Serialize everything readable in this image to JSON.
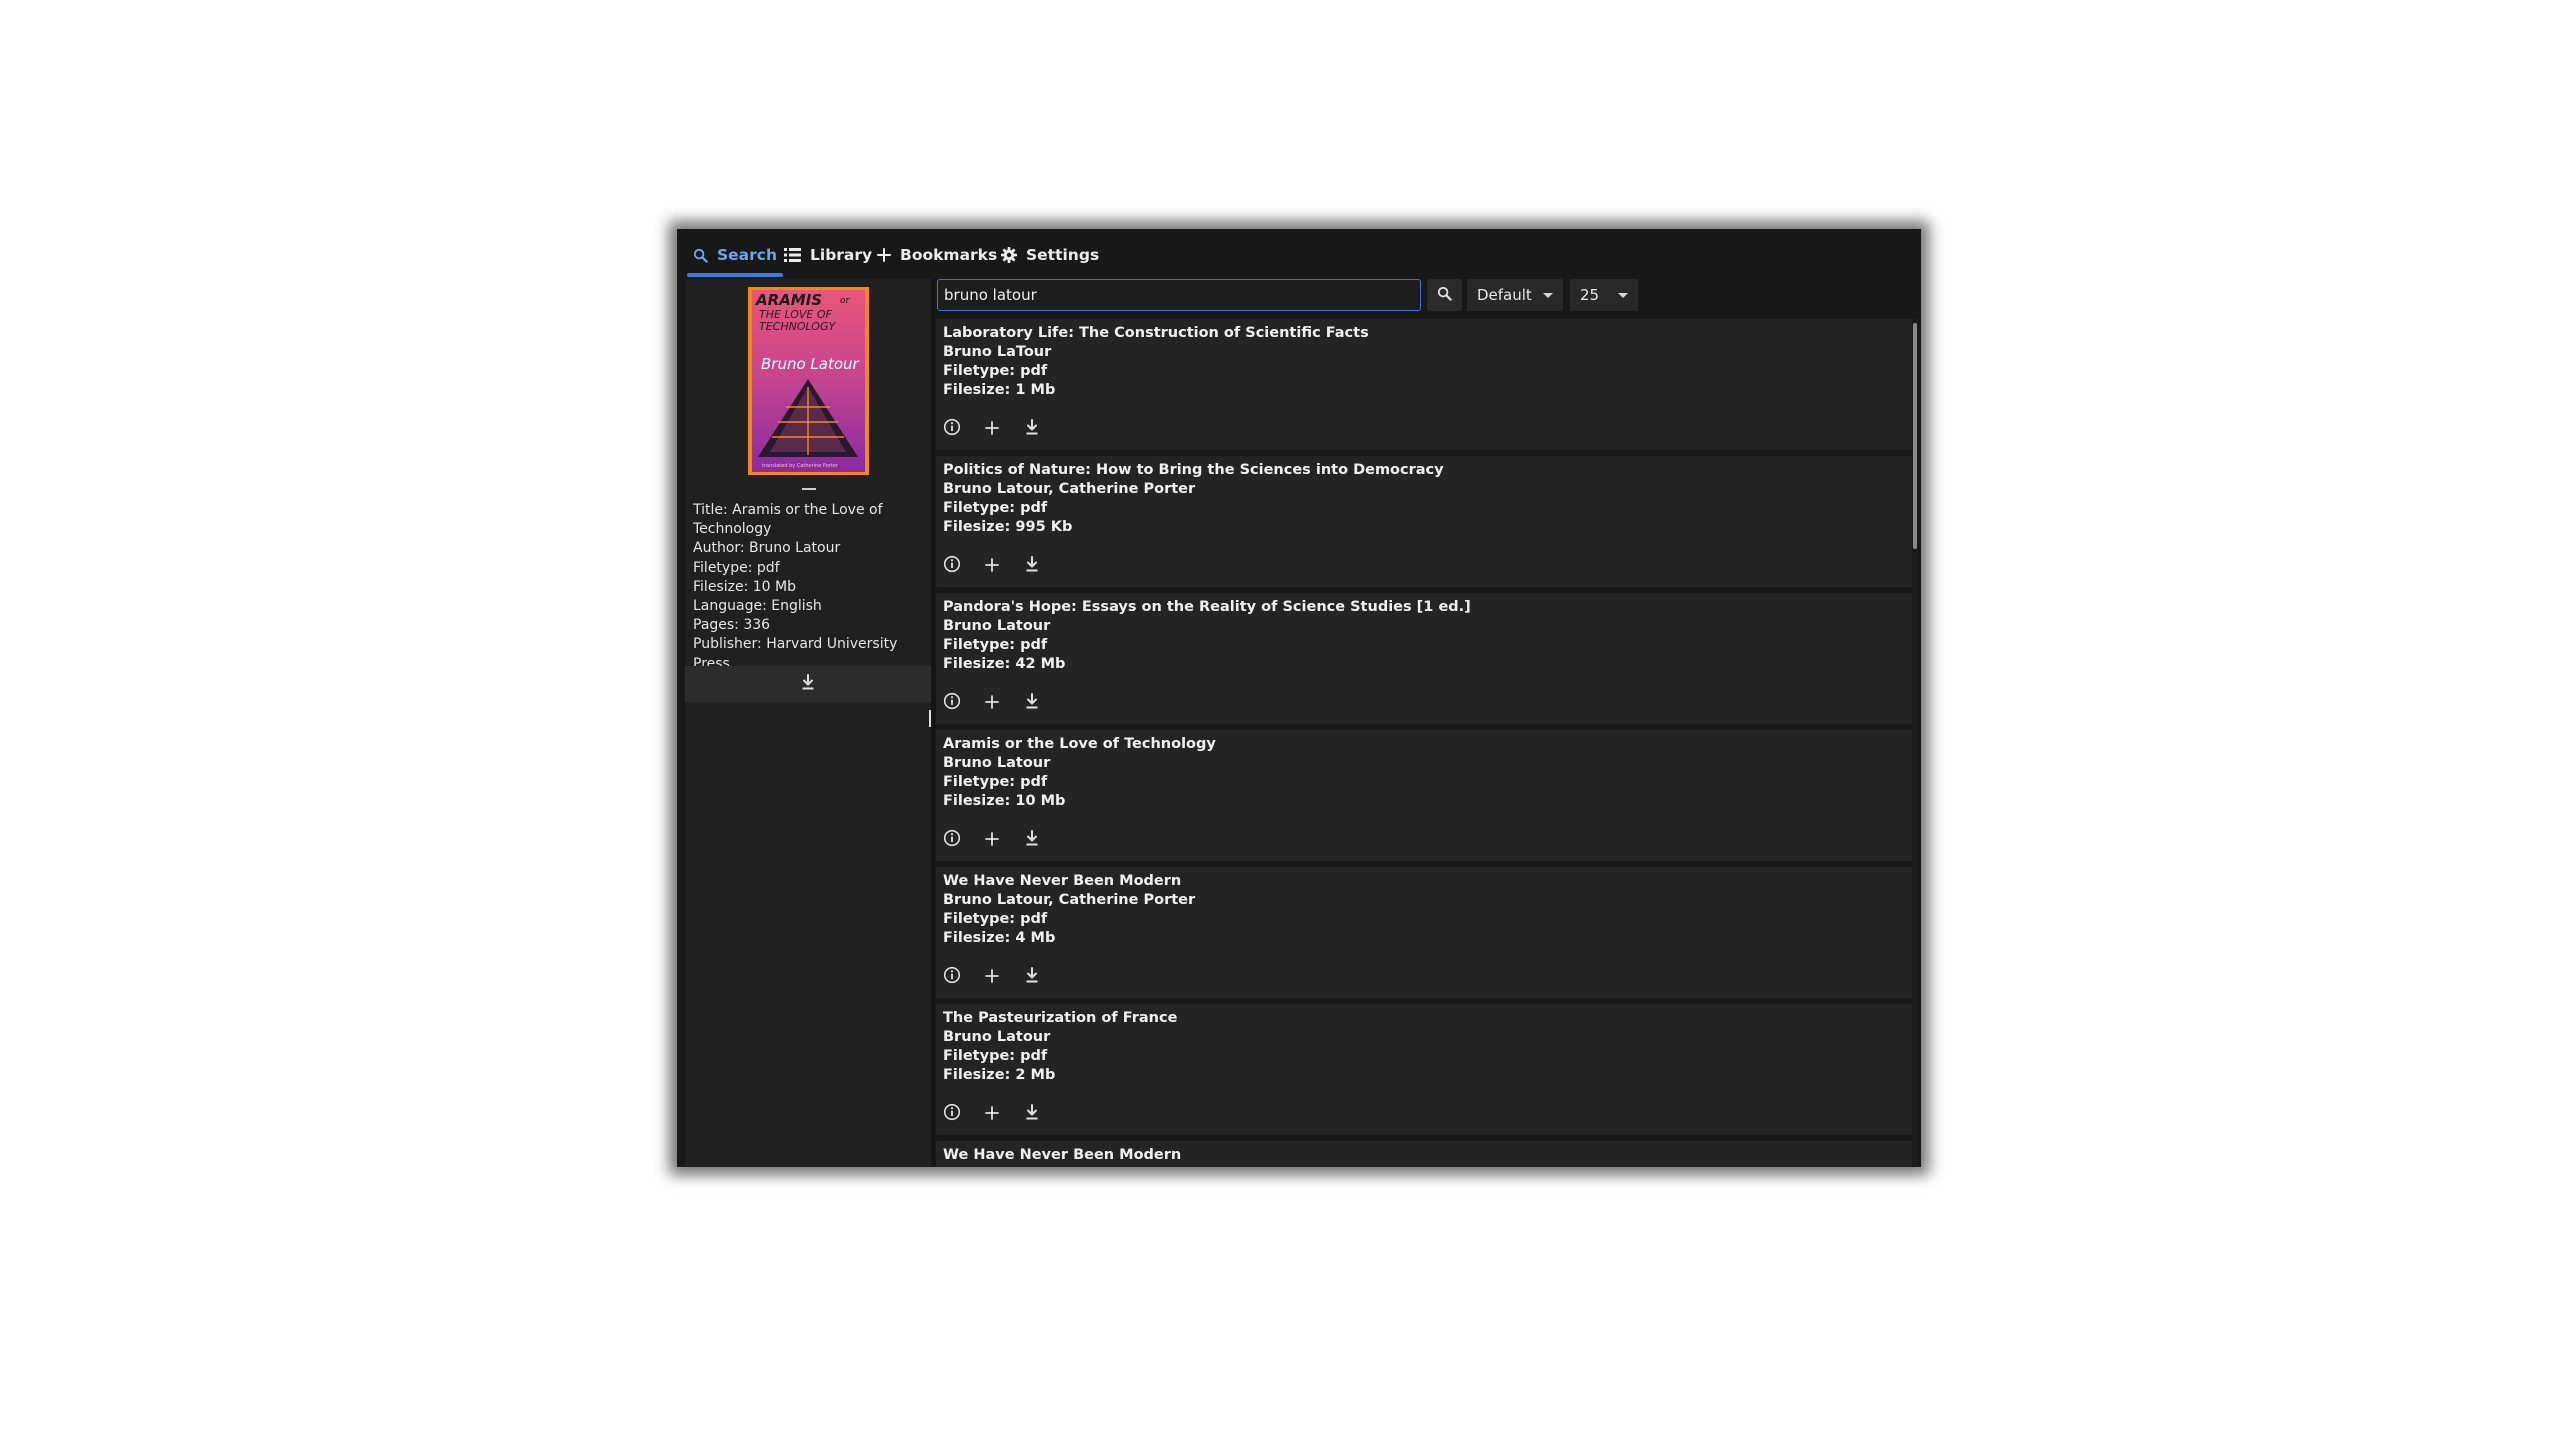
{
  "tabs": [
    {
      "label": "Search",
      "icon": "search-icon",
      "active": true
    },
    {
      "label": "Library",
      "icon": "list-icon",
      "active": false
    },
    {
      "label": "Bookmarks",
      "icon": "plus-icon",
      "active": false
    },
    {
      "label": "Settings",
      "icon": "gear-icon",
      "active": false
    }
  ],
  "search": {
    "value": "bruno latour"
  },
  "sort_select": {
    "value": "Default"
  },
  "count_select": {
    "value": "25"
  },
  "selected_book": {
    "cover": {
      "title_lines": [
        "ARAMIS",
        "or",
        "THE LOVE OF",
        "TECHNOLOGY"
      ],
      "author": "Bruno Latour",
      "bottom_text": "translated by Catherine Porter",
      "colors": {
        "background": "#d7436a",
        "border": "#f08a12",
        "text": "#1a1a1a"
      }
    },
    "meta": [
      "Title: Aramis or the Love of Technology",
      "Author: Bruno Latour",
      "Filetype: pdf",
      "Filesize: 10 Mb",
      "Language: English",
      "Pages: 336",
      "Publisher: Harvard University Press"
    ]
  },
  "results": [
    {
      "title": "Laboratory Life: The Construction of Scientific Facts",
      "author": "Bruno LaTour",
      "filetype": "Filetype: pdf",
      "filesize": "Filesize: 1 Mb"
    },
    {
      "title": "Politics of Nature: How to Bring the Sciences into Democracy",
      "author": "Bruno Latour, Catherine Porter",
      "filetype": "Filetype: pdf",
      "filesize": "Filesize: 995 Kb"
    },
    {
      "title": "Pandora's Hope: Essays on the Reality of Science Studies [1 ed.]",
      "author": "Bruno Latour",
      "filetype": "Filetype: pdf",
      "filesize": "Filesize: 42 Mb"
    },
    {
      "title": "Aramis or the Love of Technology",
      "author": "Bruno Latour",
      "filetype": "Filetype: pdf",
      "filesize": "Filesize: 10 Mb"
    },
    {
      "title": "We Have Never Been Modern",
      "author": "Bruno Latour, Catherine Porter",
      "filetype": "Filetype: pdf",
      "filesize": "Filesize: 4 Mb"
    },
    {
      "title": "The Pasteurization of France",
      "author": "Bruno Latour",
      "filetype": "Filetype: pdf",
      "filesize": "Filesize: 2 Mb"
    },
    {
      "title": "We Have Never Been Modern",
      "author": "",
      "filetype": "",
      "filesize": ""
    }
  ],
  "result_actions": [
    "info-icon",
    "plus-icon",
    "download-icon"
  ],
  "colors": {
    "accent": "#3b7ae0",
    "window_bg": "#181818",
    "card_bg": "#242424"
  }
}
